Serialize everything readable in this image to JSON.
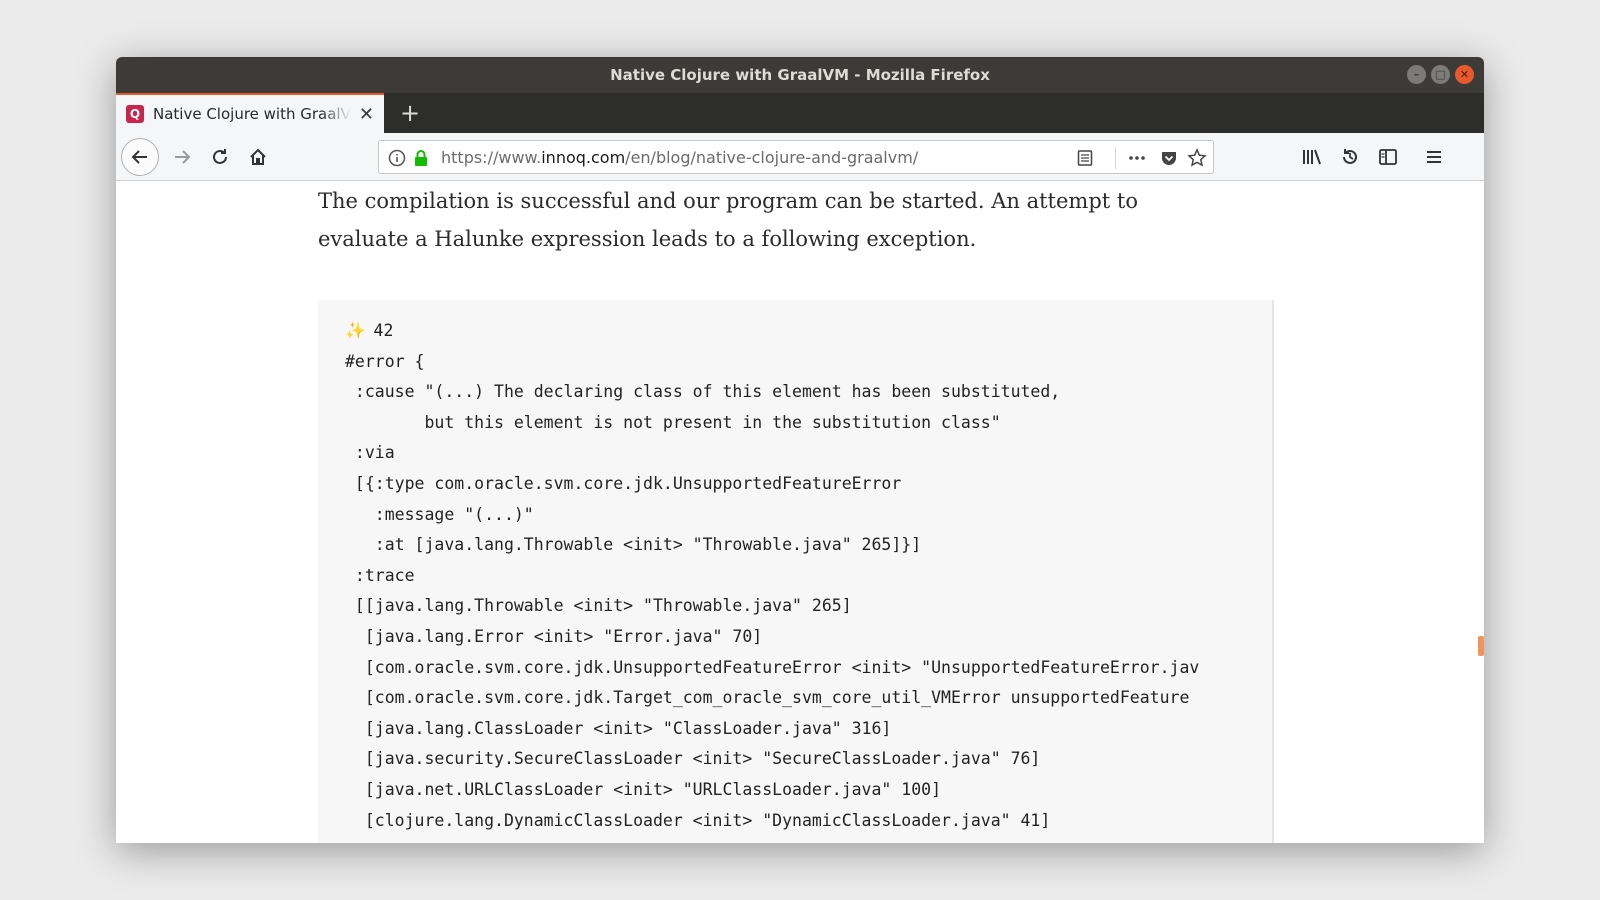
{
  "window": {
    "title": "Native Clojure with GraalVM - Mozilla Firefox"
  },
  "tab": {
    "title": "Native Clojure with GraalVM",
    "favicon_letter": "Q"
  },
  "urlbar": {
    "prefix": "https://www.",
    "host": "innoq.com",
    "path": "/en/blog/native-clojure-and-graalvm/"
  },
  "article": {
    "paragraph": "The compilation is successful and our program can be started. An attempt to evaluate a Halunke expression leads to a following exception."
  },
  "code": {
    "prompt_symbol": "✨",
    "lines": [
      "42",
      "#error {",
      " :cause \"(...) The declaring class of this element has been substituted,",
      "        but this element is not present in the substitution class\"",
      " :via",
      " [{:type com.oracle.svm.core.jdk.UnsupportedFeatureError",
      "   :message \"(...)\"",
      "   :at [java.lang.Throwable <init> \"Throwable.java\" 265]}]",
      " :trace",
      " [[java.lang.Throwable <init> \"Throwable.java\" 265]",
      "  [java.lang.Error <init> \"Error.java\" 70]",
      "  [com.oracle.svm.core.jdk.UnsupportedFeatureError <init> \"UnsupportedFeatureError.jav",
      "  [com.oracle.svm.core.jdk.Target_com_oracle_svm_core_util_VMError unsupportedFeature",
      "  [java.lang.ClassLoader <init> \"ClassLoader.java\" 316]",
      "  [java.security.SecureClassLoader <init> \"SecureClassLoader.java\" 76]",
      "  [java.net.URLClassLoader <init> \"URLClassLoader.java\" 100]",
      "  [clojure.lang.DynamicClassLoader <init> \"DynamicClassLoader.java\" 41]"
    ]
  },
  "colors": {
    "titlebar": "#3c3b37",
    "tab_accent": "#e35b2b",
    "favicon": "#c7244e",
    "lock": "#12bc00"
  }
}
